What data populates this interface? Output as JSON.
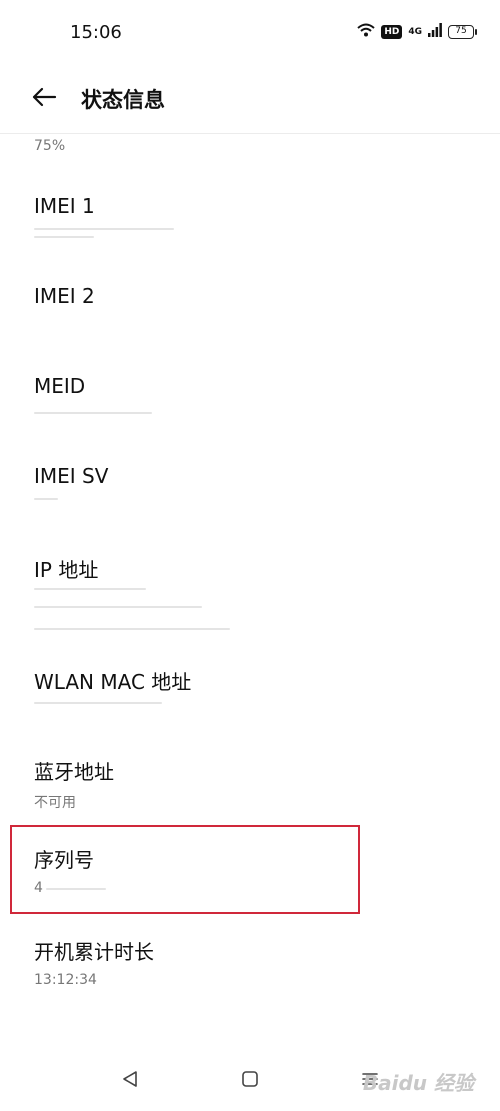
{
  "status_bar": {
    "time": "15:06",
    "hd": "HD",
    "network": "4G",
    "battery": "75"
  },
  "header": {
    "title": "状态信息",
    "back_icon": "arrow-left-icon"
  },
  "list": {
    "top_fragment": "75%",
    "items": [
      {
        "label": "IMEI 1",
        "value": ""
      },
      {
        "label": "IMEI 2",
        "value": ""
      },
      {
        "label": "MEID",
        "value": ""
      },
      {
        "label": "IMEI SV",
        "value": ""
      },
      {
        "label": "IP 地址",
        "value": ""
      },
      {
        "label": "WLAN MAC 地址",
        "value": ""
      },
      {
        "label": "蓝牙地址",
        "value": "不可用"
      },
      {
        "label": "序列号",
        "value": "4"
      },
      {
        "label": "开机累计时长",
        "value": "13:12:34"
      }
    ]
  },
  "highlight": {
    "target": "序列号",
    "color": "#d0283a"
  },
  "nav_bar": {
    "icons": [
      "back-triangle-icon",
      "home-square-icon",
      "recents-menu-icon"
    ],
    "watermark": "Baidu 经验"
  }
}
